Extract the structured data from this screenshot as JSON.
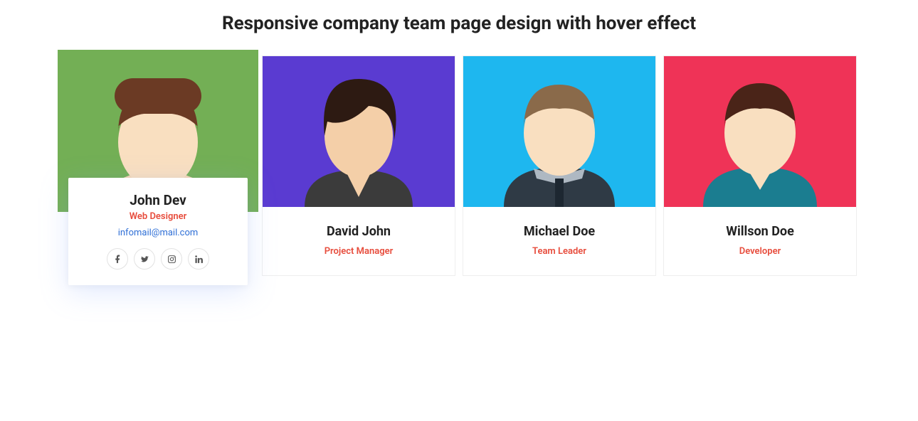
{
  "page": {
    "title": "Responsive company team page design with hover effect"
  },
  "colors": {
    "bg1": "#73af55",
    "bg2": "#5a3bd1",
    "bg3": "#1eb7ef",
    "bg4": "#ef3357",
    "role": "#e74c3c",
    "link": "#2f6fd6"
  },
  "team": [
    {
      "name": "John Dev",
      "role": "Web Designer",
      "email": "infomail@mail.com",
      "featured": true
    },
    {
      "name": "David John",
      "role": "Project Manager"
    },
    {
      "name": "Michael Doe",
      "role": "Team Leader"
    },
    {
      "name": "Willson Doe",
      "role": "Developer"
    }
  ],
  "social": {
    "facebook": "facebook-icon",
    "twitter": "twitter-icon",
    "instagram": "instagram-icon",
    "linkedin": "linkedin-icon"
  }
}
